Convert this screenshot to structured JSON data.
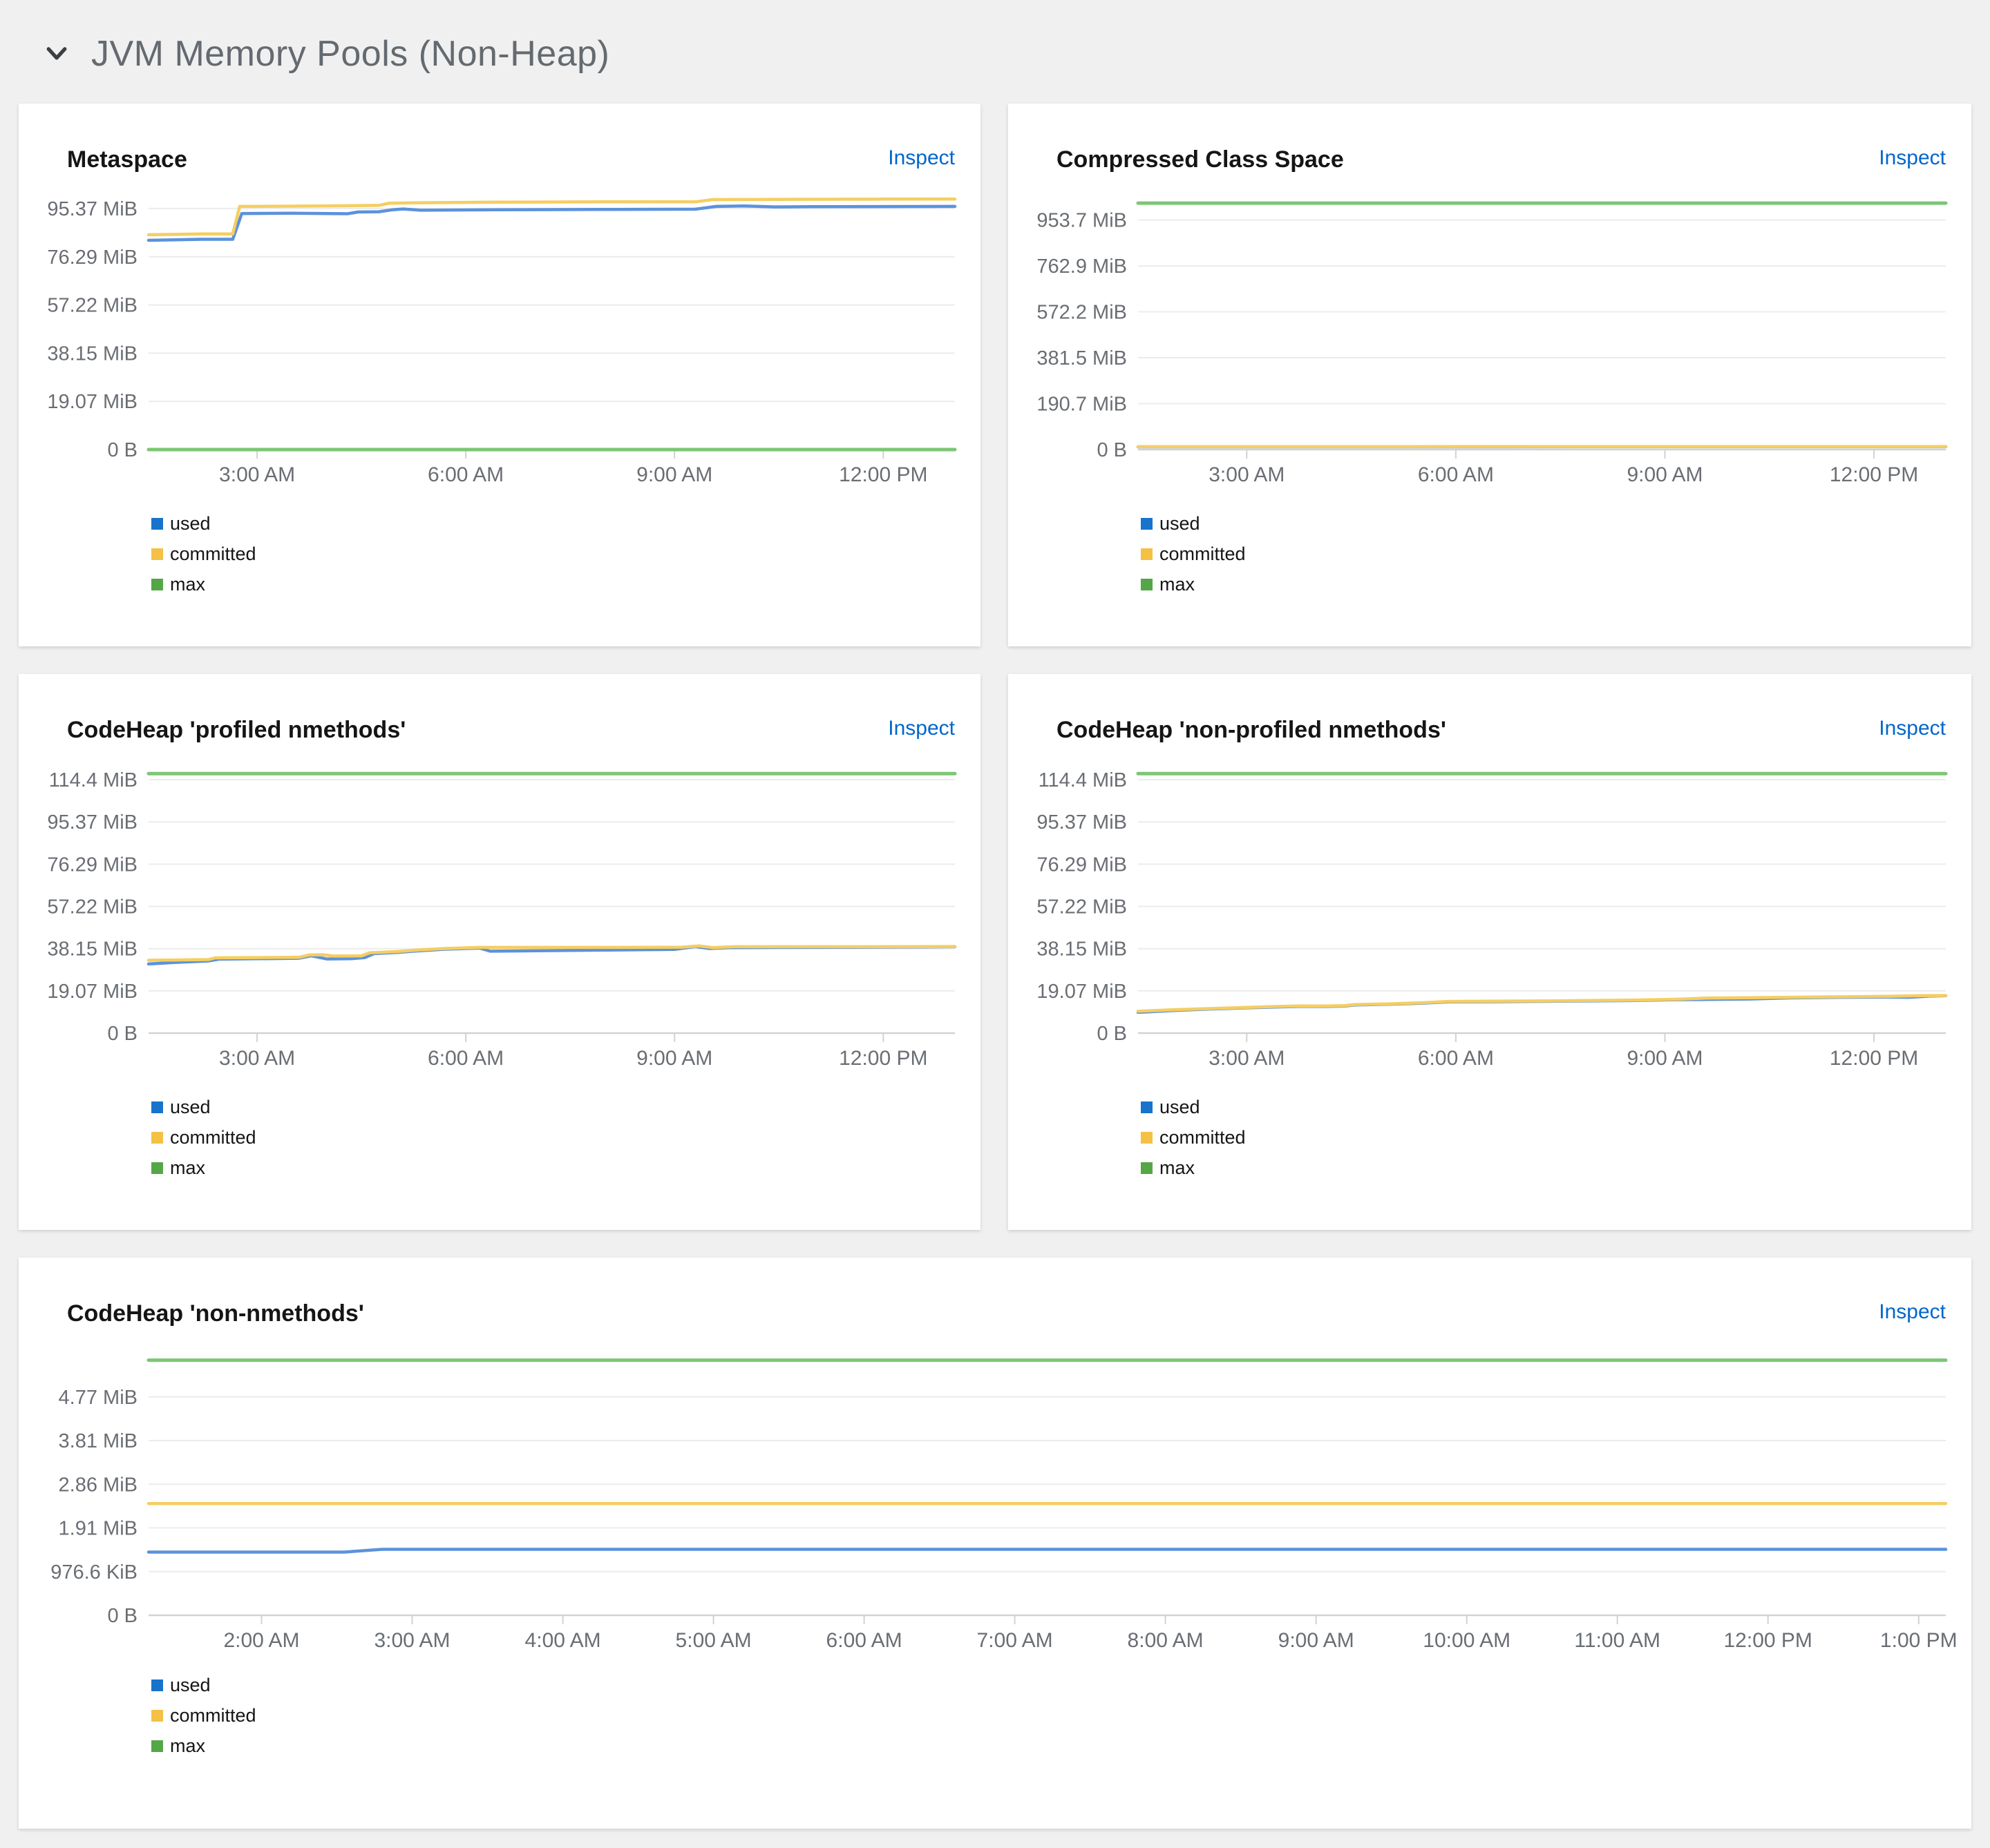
{
  "section": {
    "title": "JVM Memory Pools (Non-Heap)"
  },
  "inspect_label": "Inspect",
  "legend_order": [
    "used",
    "committed",
    "max"
  ],
  "colors": {
    "page_bg": "#f0f0f0",
    "card_bg": "#ffffff",
    "title_text": "#151515",
    "section_text": "#646a70",
    "inspect_link": "#0066cc",
    "axis_text": "#6a6e73",
    "grid_line": "#ececec",
    "axis_line": "#d2d2d2",
    "line_used": "#5b92db",
    "line_committed": "#f5ce62",
    "line_max": "#7cc674",
    "legend_used": "#1873cc",
    "legend_committed": "#f4c145",
    "legend_max": "#54a647"
  },
  "chart_data": [
    {
      "type": "line",
      "title": "Metaspace",
      "unit": "MiB",
      "x_range": [
        1.44,
        13.03
      ],
      "x_ticks": [
        {
          "t": 3,
          "label": "3:00 AM"
        },
        {
          "t": 6,
          "label": "6:00 AM"
        },
        {
          "t": 9,
          "label": "9:00 AM"
        },
        {
          "t": 12,
          "label": "12:00 PM"
        }
      ],
      "y_max": 100,
      "y_ticks": [
        {
          "v": 0,
          "label": "0 B"
        },
        {
          "v": 19.07,
          "label": "19.07 MiB"
        },
        {
          "v": 38.15,
          "label": "38.15 MiB"
        },
        {
          "v": 57.22,
          "label": "57.22 MiB"
        },
        {
          "v": 76.29,
          "label": "76.29 MiB"
        },
        {
          "v": 95.37,
          "label": "95.37 MiB"
        }
      ],
      "series": [
        {
          "name": "used",
          "points": [
            [
              1.44,
              82.8
            ],
            [
              2.2,
              83.2
            ],
            [
              2.65,
              83.2
            ],
            [
              2.78,
              93.4
            ],
            [
              3.5,
              93.5
            ],
            [
              4.3,
              93.3
            ],
            [
              4.45,
              94.0
            ],
            [
              4.75,
              94.1
            ],
            [
              4.95,
              94.9
            ],
            [
              5.1,
              95.2
            ],
            [
              5.35,
              94.7
            ],
            [
              6.4,
              94.9
            ],
            [
              8.0,
              95.0
            ],
            [
              9.3,
              95.1
            ],
            [
              9.6,
              96.2
            ],
            [
              10.0,
              96.4
            ],
            [
              10.45,
              96.0
            ],
            [
              11.0,
              96.1
            ],
            [
              13.03,
              96.2
            ]
          ]
        },
        {
          "name": "committed",
          "points": [
            [
              1.44,
              85.0
            ],
            [
              2.2,
              85.3
            ],
            [
              2.65,
              85.3
            ],
            [
              2.75,
              96.2
            ],
            [
              3.5,
              96.3
            ],
            [
              4.4,
              96.5
            ],
            [
              4.75,
              96.6
            ],
            [
              4.9,
              97.5
            ],
            [
              5.2,
              97.6
            ],
            [
              6.4,
              97.9
            ],
            [
              8.0,
              98.0
            ],
            [
              9.3,
              98.0
            ],
            [
              9.55,
              98.9
            ],
            [
              10.5,
              99.0
            ],
            [
              12.0,
              99.1
            ],
            [
              13.03,
              99.1
            ]
          ]
        },
        {
          "name": "max",
          "points": [
            [
              1.44,
              0
            ],
            [
              13.03,
              0
            ]
          ]
        }
      ]
    },
    {
      "type": "line",
      "title": "Compressed Class Space",
      "unit": "MiB",
      "x_range": [
        1.44,
        13.03
      ],
      "x_ticks": [
        {
          "t": 3,
          "label": "3:00 AM"
        },
        {
          "t": 6,
          "label": "6:00 AM"
        },
        {
          "t": 9,
          "label": "9:00 AM"
        },
        {
          "t": 12,
          "label": "12:00 PM"
        }
      ],
      "y_max": 1050,
      "y_ticks": [
        {
          "v": 0,
          "label": "0 B"
        },
        {
          "v": 190.74,
          "label": "190.7 MiB"
        },
        {
          "v": 381.47,
          "label": "381.5 MiB"
        },
        {
          "v": 572.2,
          "label": "572.2 MiB"
        },
        {
          "v": 762.94,
          "label": "762.9 MiB"
        },
        {
          "v": 953.67,
          "label": "953.7 MiB"
        }
      ],
      "series": [
        {
          "name": "used",
          "points": [
            [
              1.44,
              11.4
            ],
            [
              5.0,
              11.6
            ],
            [
              9.0,
              11.8
            ],
            [
              13.03,
              11.9
            ]
          ]
        },
        {
          "name": "committed",
          "points": [
            [
              1.44,
              12.3
            ],
            [
              5.0,
              12.4
            ],
            [
              9.0,
              12.6
            ],
            [
              13.03,
              12.6
            ]
          ]
        },
        {
          "name": "max",
          "points": [
            [
              1.44,
              1024
            ],
            [
              13.03,
              1024
            ]
          ]
        }
      ]
    },
    {
      "type": "line",
      "title": "CodeHeap 'profiled nmethods'",
      "unit": "MiB",
      "x_range": [
        1.44,
        13.03
      ],
      "x_ticks": [
        {
          "t": 3,
          "label": "3:00 AM"
        },
        {
          "t": 6,
          "label": "6:00 AM"
        },
        {
          "t": 9,
          "label": "9:00 AM"
        },
        {
          "t": 12,
          "label": "12:00 PM"
        }
      ],
      "y_max": 118.5,
      "y_ticks": [
        {
          "v": 0,
          "label": "0 B"
        },
        {
          "v": 19.07,
          "label": "19.07 MiB"
        },
        {
          "v": 38.15,
          "label": "38.15 MiB"
        },
        {
          "v": 57.22,
          "label": "57.22 MiB"
        },
        {
          "v": 76.29,
          "label": "76.29 MiB"
        },
        {
          "v": 95.37,
          "label": "95.37 MiB"
        },
        {
          "v": 114.44,
          "label": "114.4 MiB"
        }
      ],
      "series": [
        {
          "name": "used",
          "points": [
            [
              1.44,
              31.2
            ],
            [
              1.8,
              31.9
            ],
            [
              2.3,
              32.6
            ],
            [
              2.45,
              33.4
            ],
            [
              3.0,
              33.6
            ],
            [
              3.6,
              33.8
            ],
            [
              3.78,
              34.9
            ],
            [
              4.0,
              33.5
            ],
            [
              4.35,
              33.6
            ],
            [
              4.55,
              34.1
            ],
            [
              4.68,
              35.9
            ],
            [
              5.0,
              36.4
            ],
            [
              5.3,
              37.1
            ],
            [
              5.7,
              37.9
            ],
            [
              6.2,
              38.4
            ],
            [
              6.35,
              37.0
            ],
            [
              7.0,
              37.2
            ],
            [
              8.0,
              37.5
            ],
            [
              9.0,
              37.8
            ],
            [
              9.3,
              39.1
            ],
            [
              9.5,
              38.2
            ],
            [
              9.8,
              38.6
            ],
            [
              10.5,
              38.7
            ],
            [
              11.5,
              38.8
            ],
            [
              12.5,
              38.9
            ],
            [
              13.03,
              39.0
            ]
          ]
        },
        {
          "name": "committed",
          "points": [
            [
              1.44,
              32.9
            ],
            [
              2.0,
              33.1
            ],
            [
              2.3,
              33.2
            ],
            [
              2.4,
              34.0
            ],
            [
              3.0,
              34.1
            ],
            [
              3.6,
              34.2
            ],
            [
              3.75,
              35.3
            ],
            [
              3.95,
              35.4
            ],
            [
              4.1,
              34.8
            ],
            [
              4.5,
              34.9
            ],
            [
              4.62,
              36.3
            ],
            [
              5.0,
              36.8
            ],
            [
              5.3,
              37.5
            ],
            [
              5.7,
              38.2
            ],
            [
              6.2,
              38.7
            ],
            [
              7.0,
              38.7
            ],
            [
              8.0,
              38.7
            ],
            [
              9.1,
              38.8
            ],
            [
              9.35,
              39.4
            ],
            [
              9.55,
              38.6
            ],
            [
              9.85,
              39.0
            ],
            [
              11.0,
              39.0
            ],
            [
              12.0,
              39.0
            ],
            [
              13.03,
              39.1
            ]
          ]
        },
        {
          "name": "max",
          "points": [
            [
              1.44,
              117.2
            ],
            [
              13.03,
              117.2
            ]
          ]
        }
      ]
    },
    {
      "type": "line",
      "title": "CodeHeap 'non-profiled nmethods'",
      "unit": "MiB",
      "x_range": [
        1.44,
        13.03
      ],
      "x_ticks": [
        {
          "t": 3,
          "label": "3:00 AM"
        },
        {
          "t": 6,
          "label": "6:00 AM"
        },
        {
          "t": 9,
          "label": "9:00 AM"
        },
        {
          "t": 12,
          "label": "12:00 PM"
        }
      ],
      "y_max": 118.5,
      "y_ticks": [
        {
          "v": 0,
          "label": "0 B"
        },
        {
          "v": 19.07,
          "label": "19.07 MiB"
        },
        {
          "v": 38.15,
          "label": "38.15 MiB"
        },
        {
          "v": 57.22,
          "label": "57.22 MiB"
        },
        {
          "v": 76.29,
          "label": "76.29 MiB"
        },
        {
          "v": 95.37,
          "label": "95.37 MiB"
        },
        {
          "v": 114.44,
          "label": "114.4 MiB"
        }
      ],
      "series": [
        {
          "name": "used",
          "points": [
            [
              1.44,
              9.4
            ],
            [
              2.0,
              10.3
            ],
            [
              2.5,
              10.9
            ],
            [
              3.0,
              11.4
            ],
            [
              3.4,
              11.8
            ],
            [
              3.8,
              12.1
            ],
            [
              4.1,
              12.0
            ],
            [
              4.4,
              12.2
            ],
            [
              4.55,
              12.7
            ],
            [
              5.0,
              13.0
            ],
            [
              5.5,
              13.5
            ],
            [
              5.9,
              14.1
            ],
            [
              6.5,
              14.2
            ],
            [
              7.5,
              14.4
            ],
            [
              8.5,
              14.7
            ],
            [
              9.2,
              15.1
            ],
            [
              9.6,
              15.2
            ],
            [
              10.2,
              15.4
            ],
            [
              10.8,
              15.9
            ],
            [
              11.5,
              16.2
            ],
            [
              12.2,
              16.3
            ],
            [
              12.5,
              16.2
            ],
            [
              12.8,
              16.7
            ],
            [
              13.03,
              16.9
            ]
          ]
        },
        {
          "name": "committed",
          "points": [
            [
              1.44,
              9.9
            ],
            [
              2.0,
              10.6
            ],
            [
              2.5,
              11.1
            ],
            [
              3.0,
              11.6
            ],
            [
              3.4,
              12.0
            ],
            [
              3.8,
              12.3
            ],
            [
              4.1,
              12.2
            ],
            [
              4.4,
              12.4
            ],
            [
              4.55,
              12.9
            ],
            [
              5.0,
              13.2
            ],
            [
              5.5,
              13.7
            ],
            [
              5.9,
              14.3
            ],
            [
              6.5,
              14.4
            ],
            [
              7.5,
              14.6
            ],
            [
              8.5,
              14.9
            ],
            [
              9.2,
              15.3
            ],
            [
              9.6,
              15.8
            ],
            [
              10.2,
              16.0
            ],
            [
              10.8,
              16.2
            ],
            [
              11.5,
              16.4
            ],
            [
              12.2,
              16.6
            ],
            [
              12.7,
              16.9
            ],
            [
              13.03,
              17.0
            ]
          ]
        },
        {
          "name": "max",
          "points": [
            [
              1.44,
              117.2
            ],
            [
              13.03,
              117.2
            ]
          ]
        }
      ]
    },
    {
      "type": "line",
      "title": "CodeHeap 'non-nmethods'",
      "unit": "MiB",
      "x_range": [
        1.25,
        13.18
      ],
      "x_ticks": [
        {
          "t": 2,
          "label": "2:00 AM"
        },
        {
          "t": 3,
          "label": "3:00 AM"
        },
        {
          "t": 4,
          "label": "4:00 AM"
        },
        {
          "t": 5,
          "label": "5:00 AM"
        },
        {
          "t": 6,
          "label": "6:00 AM"
        },
        {
          "t": 7,
          "label": "7:00 AM"
        },
        {
          "t": 8,
          "label": "8:00 AM"
        },
        {
          "t": 9,
          "label": "9:00 AM"
        },
        {
          "t": 10,
          "label": "10:00 AM"
        },
        {
          "t": 11,
          "label": "11:00 AM"
        },
        {
          "t": 12,
          "label": "12:00 PM"
        },
        {
          "t": 13,
          "label": "1:00 PM"
        }
      ],
      "y_max": 5.7,
      "y_ticks": [
        {
          "v": 0,
          "label": "0 B"
        },
        {
          "v": 0.9537,
          "label": "976.6 KiB"
        },
        {
          "v": 1.9073,
          "label": "1.91 MiB"
        },
        {
          "v": 2.861,
          "label": "2.86 MiB"
        },
        {
          "v": 3.8147,
          "label": "3.81 MiB"
        },
        {
          "v": 4.7684,
          "label": "4.77 MiB"
        }
      ],
      "series": [
        {
          "name": "used",
          "points": [
            [
              1.25,
              1.38
            ],
            [
              2.55,
              1.38
            ],
            [
              2.8,
              1.44
            ],
            [
              13.18,
              1.44
            ]
          ]
        },
        {
          "name": "committed",
          "points": [
            [
              1.25,
              2.44
            ],
            [
              13.18,
              2.44
            ]
          ]
        },
        {
          "name": "max",
          "points": [
            [
              1.25,
              5.57
            ],
            [
              13.18,
              5.57
            ]
          ]
        }
      ]
    }
  ]
}
